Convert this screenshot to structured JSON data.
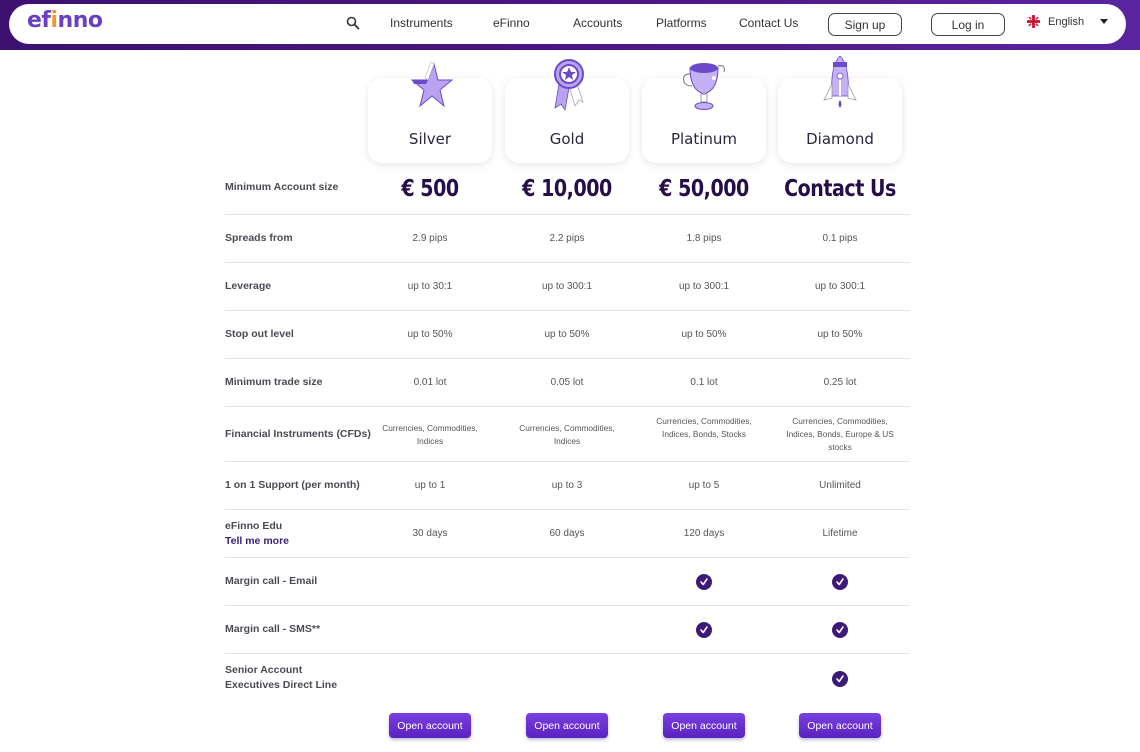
{
  "header": {
    "logo": "efinno",
    "nav": [
      "Instruments",
      "eFinno",
      "Accounts",
      "Platforms",
      "Contact Us"
    ],
    "signup_label": "Sign up",
    "login_label": "Log in",
    "language": "English",
    "brand_color": "#4a1585",
    "accent_color": "#6a3fc4"
  },
  "plans": [
    {
      "name": "Silver",
      "icon": "star-icon",
      "price": "€ 500"
    },
    {
      "name": "Gold",
      "icon": "medal-icon",
      "price": "€ 10,000"
    },
    {
      "name": "Platinum",
      "icon": "trophy-icon",
      "price": "€ 50,000"
    },
    {
      "name": "Diamond",
      "icon": "rocket-icon",
      "price": "Contact Us"
    }
  ],
  "table": {
    "price_label": "Minimum Account size",
    "rows": [
      {
        "label": "Spreads from",
        "values": [
          "2.9 pips",
          "2.2 pips",
          "1.8 pips",
          "0.1 pips"
        ]
      },
      {
        "label": "Leverage",
        "values": [
          "up to 30:1",
          "up to 300:1",
          "up to 300:1",
          "up to 300:1"
        ]
      },
      {
        "label": "Stop out level",
        "values": [
          "up to 50%",
          "up to 50%",
          "up to 50%",
          "up to 50%"
        ]
      },
      {
        "label": "Minimum trade size",
        "values": [
          "0.01 lot",
          "0.05 lot",
          "0.1 lot",
          "0.25 lot"
        ]
      },
      {
        "label": "Financial Instruments (CFDs)",
        "values": [
          "Currencies, Commodities, Indices",
          "Currencies, Commodities, Indices",
          "Currencies, Commodities, Indices, Bonds, Stocks",
          "Currencies, Commodities, Indices, Bonds, Europe & US stocks"
        ]
      },
      {
        "label": "1 on 1 Support (per month)",
        "values": [
          "up to 1",
          "up to 3",
          "up to 5",
          "Unlimited"
        ]
      },
      {
        "label": "eFinno Edu",
        "link": "Tell me more",
        "values": [
          "30 days",
          "60 days",
          "120 days",
          "Lifetime"
        ]
      },
      {
        "label": "Margin call - Email",
        "checks": [
          false,
          false,
          true,
          true
        ]
      },
      {
        "label": "Margin call - SMS**",
        "checks": [
          false,
          false,
          true,
          true
        ]
      },
      {
        "label": "Senior Account Executives Direct Line",
        "checks": [
          false,
          false,
          false,
          true
        ]
      }
    ]
  },
  "cta_label": "Open account"
}
